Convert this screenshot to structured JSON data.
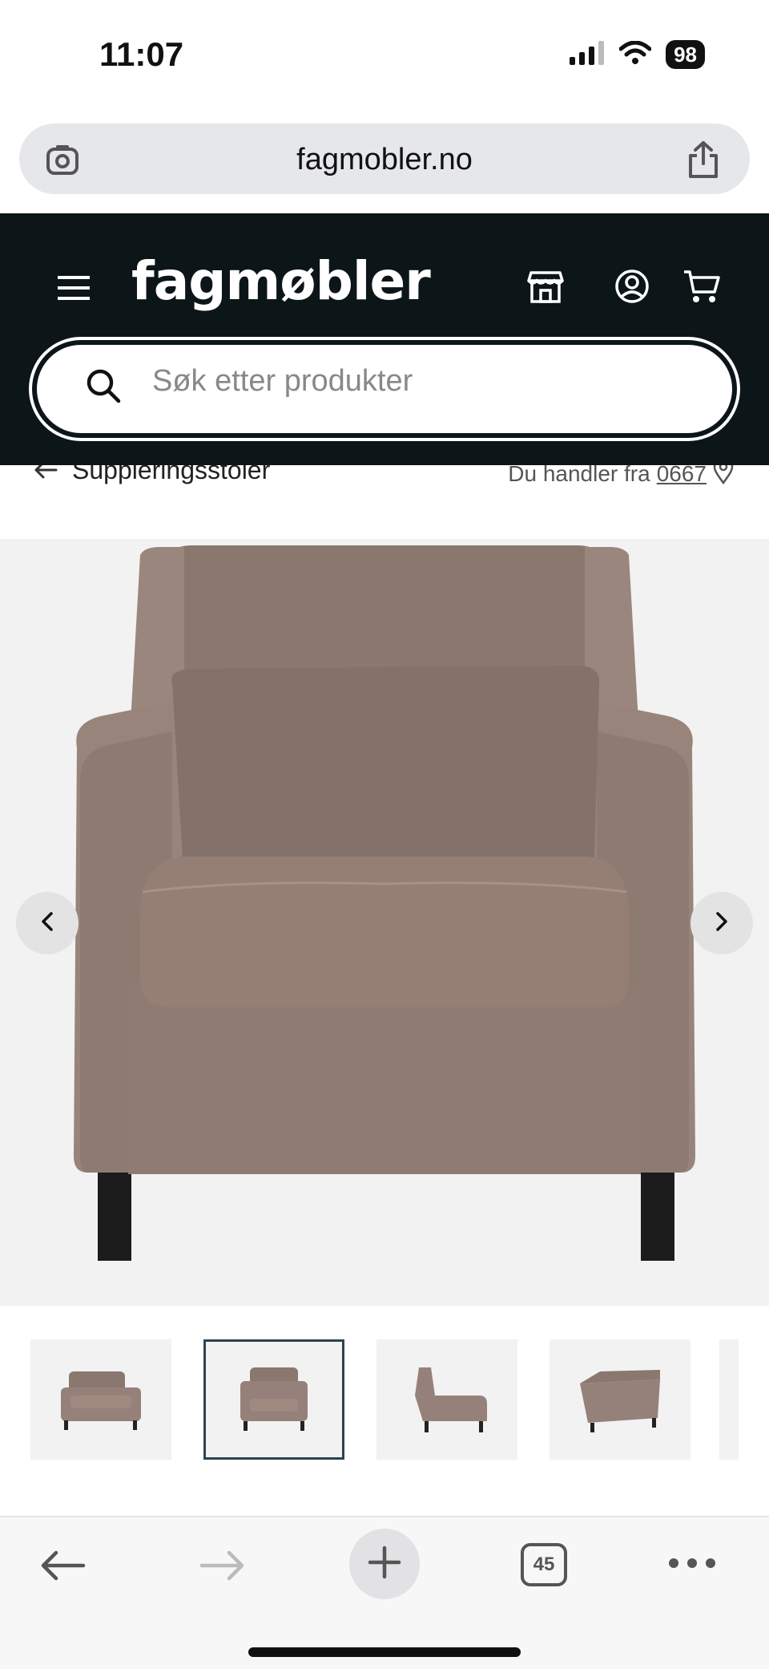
{
  "status": {
    "time": "11:07",
    "battery": "98"
  },
  "browser": {
    "url": "fagmobler.no",
    "tab_count": "45"
  },
  "header": {
    "logo": "fagmøbler",
    "search_placeholder": "Søk etter produkter"
  },
  "breadcrumb": {
    "back_label": "Suppleringsstoler",
    "store_prefix": "Du handler fra",
    "postal_code": "0667"
  },
  "product": {
    "color": "#8f7b72",
    "thumbnails": [
      "front-angle",
      "front",
      "side",
      "back-angle"
    ],
    "active_thumbnail": 1
  },
  "icons": [
    "menu-icon",
    "store-icon",
    "user-icon",
    "cart-icon",
    "search-icon",
    "location-pin-icon",
    "back-arrow-icon"
  ]
}
